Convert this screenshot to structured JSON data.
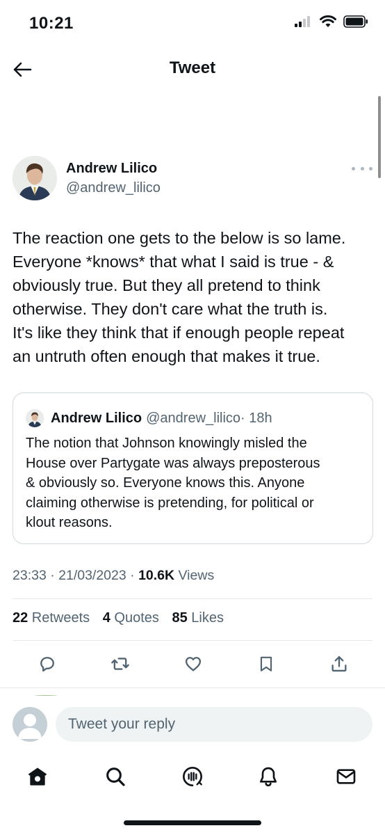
{
  "status_bar": {
    "time": "10:21"
  },
  "header": {
    "title": "Tweet"
  },
  "tweet": {
    "author_name": "Andrew Lilico",
    "author_handle": "@andrew_lilico",
    "text_lines": [
      "The reaction one gets to the below is so lame.",
      "Everyone *knows* that what I said is true - &",
      "obviously true. But they all pretend to think",
      "otherwise. They don't care what the truth is.",
      "It's like they think that if enough people repeat",
      "an untruth often enough that makes it true."
    ],
    "timestamp": "23:33 · 21/03/2023 · ",
    "views_count": "10.6K",
    "views_label": " Views",
    "retweets_count": "22",
    "retweets_label": " Retweets",
    "quotes_count": "4",
    "quotes_label": " Quotes",
    "likes_count": "85",
    "likes_label": " Likes"
  },
  "quoted_tweet": {
    "author_name": "Andrew Lilico",
    "author_handle": "@andrew_lilico",
    "time_ago": " · 18h",
    "text_lines": [
      "The notion that Johnson knowingly misled the",
      "House over Partygate was always preposterous",
      "& obviously so. Everyone knows this. Anyone",
      "claiming otherwise is pretending, for political or",
      "klout reasons."
    ]
  },
  "actions": {
    "reply_icon": "reply-icon",
    "retweet_icon": "retweet-icon",
    "like_icon": "heart-icon",
    "bookmark_icon": "bookmark-icon",
    "share_icon": "share-icon"
  },
  "reply_bar": {
    "placeholder": "Tweet your reply"
  },
  "tabbar": [
    "home-icon",
    "search-icon",
    "spaces-icon",
    "notifications-icon",
    "messages-icon"
  ],
  "colors": {
    "text": "#0f1419",
    "secondary": "#536471",
    "border": "#cfd9de",
    "input_bg": "#eff3f4"
  }
}
